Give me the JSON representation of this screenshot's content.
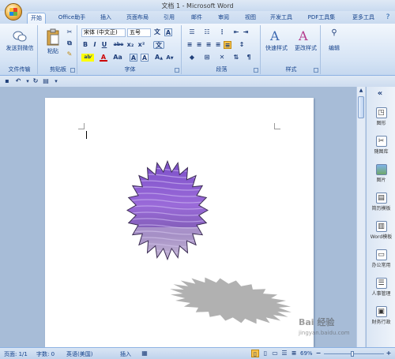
{
  "window": {
    "title": "文档 1 - Microsoft Word"
  },
  "tabs": [
    "开始",
    "Office助手",
    "插入",
    "页面布局",
    "引用",
    "邮件",
    "审阅",
    "视图",
    "开发工具",
    "PDF工具集",
    "更多工具"
  ],
  "ribbon": {
    "wechat": {
      "label": "发送到微信",
      "group": "文件传输"
    },
    "clipboard": {
      "paste": "粘贴",
      "group": "剪贴板"
    },
    "font": {
      "name": "宋体 (中文正)",
      "size": "五号",
      "group": "字体",
      "grow": "A",
      "shrink": "A",
      "bold": "B",
      "italic": "I",
      "underline": "U",
      "strike": "abe",
      "sub": "x₂",
      "sup": "x²",
      "aa": "Aa",
      "wen": "文",
      "highlight": "ab⁄",
      "fontcolor": "A"
    },
    "paragraph": {
      "group": "段落"
    },
    "styles": {
      "quick": "快速样式",
      "change": "更改样式",
      "group": "样式"
    },
    "editing": {
      "label": "编辑"
    }
  },
  "side_panel": {
    "collapse": "«",
    "items": [
      {
        "label": "图形",
        "icon": "shape-icon"
      },
      {
        "label": "随图库",
        "icon": "scissors-icon"
      },
      {
        "label": "图片",
        "icon": "picture-icon"
      },
      {
        "label": "简历模板",
        "icon": "resume-icon"
      },
      {
        "label": "Word模板",
        "icon": "word-template-icon"
      },
      {
        "label": "办公常用",
        "icon": "office-icon"
      },
      {
        "label": "人事管理",
        "icon": "hr-icon"
      },
      {
        "label": "财务行政",
        "icon": "finance-icon"
      }
    ]
  },
  "status": {
    "page": "页面: 1/1",
    "words": "字数: 0",
    "lang": "英语(美国)",
    "mode": "插入",
    "zoom": "69%"
  },
  "watermark": {
    "brand": "Bai 经验",
    "url": "jingyan.baidu.com"
  }
}
